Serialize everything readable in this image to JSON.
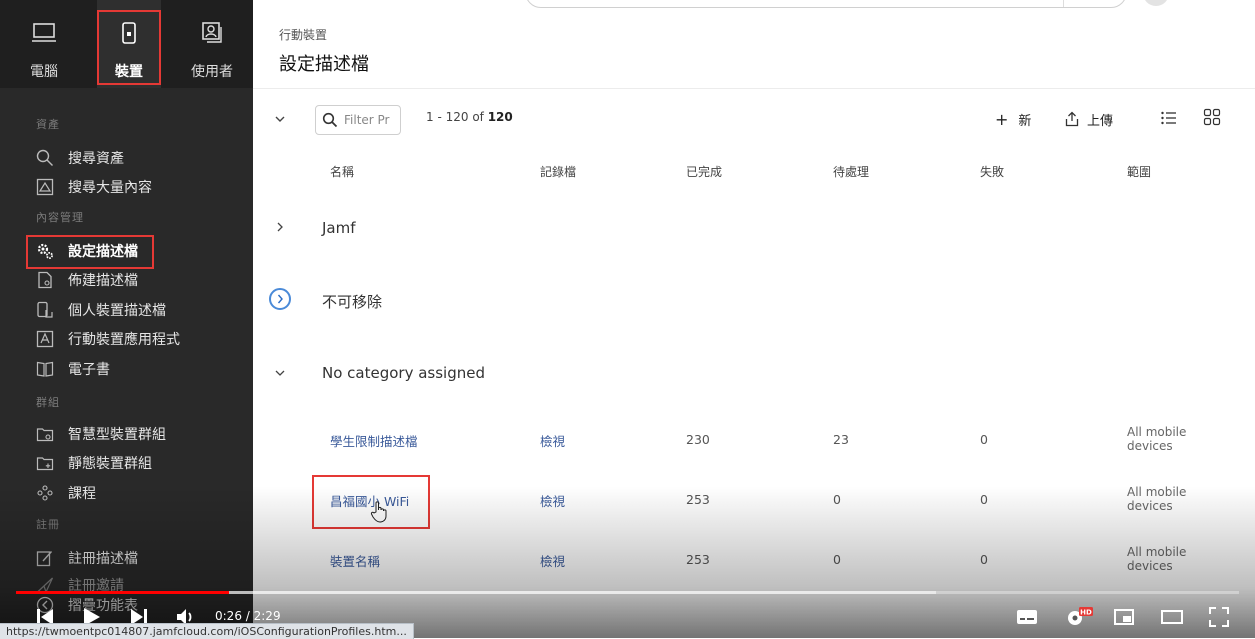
{
  "sidebar": {
    "tabs": [
      {
        "label": "電腦",
        "icon": "computer-icon"
      },
      {
        "label": "裝置",
        "icon": "mobile-device-icon"
      },
      {
        "label": "使用者",
        "icon": "users-icon"
      }
    ],
    "sections": {
      "assets": "資產",
      "content": "內容管理",
      "groups": "群組",
      "enrollment": "註冊"
    },
    "items": [
      {
        "label": "搜尋資產",
        "icon": "search-icon"
      },
      {
        "label": "搜尋大量內容",
        "icon": "image-search-icon"
      },
      {
        "label": "設定描述檔",
        "icon": "gears-icon"
      },
      {
        "label": "佈建描述檔",
        "icon": "provisioning-doc-icon"
      },
      {
        "label": "個人裝置描述檔",
        "icon": "personal-device-icon"
      },
      {
        "label": "行動裝置應用程式",
        "icon": "app-store-icon"
      },
      {
        "label": "電子書",
        "icon": "book-icon"
      },
      {
        "label": "智慧型裝置群組",
        "icon": "smart-group-folder-icon"
      },
      {
        "label": "靜態裝置群組",
        "icon": "static-group-folder-icon"
      },
      {
        "label": "課程",
        "icon": "classes-icon"
      },
      {
        "label": "註冊描述檔",
        "icon": "enrollment-doc-icon"
      },
      {
        "label": "註冊邀請",
        "icon": "invite-icon"
      },
      {
        "label": "摺疊功能表",
        "icon": "collapse-icon"
      }
    ]
  },
  "header": {
    "breadcrumb": "行動裝置",
    "title": "設定描述檔"
  },
  "toolbar": {
    "filter_placeholder": "Filter Pr",
    "count_prefix": "1 - 120 of ",
    "count_total": "120",
    "new_label": "新",
    "upload_label": "上傳"
  },
  "table": {
    "columns": [
      "名稱",
      "記錄檔",
      "已完成",
      "待處理",
      "失敗",
      "範圍"
    ],
    "categories": [
      "Jamf",
      "不可移除",
      "No category assigned"
    ],
    "rows": [
      {
        "name": "學生限制描述檔",
        "log": "檢視",
        "completed": "230",
        "pending": "23",
        "failed": "0",
        "scope_l1": "All mobile",
        "scope_l2": "devices"
      },
      {
        "name": "昌福國小 WiFi",
        "log": "檢視",
        "completed": "253",
        "pending": "0",
        "failed": "0",
        "scope_l1": "All mobile",
        "scope_l2": "devices"
      },
      {
        "name": "裝置名稱",
        "log": "檢視",
        "completed": "253",
        "pending": "0",
        "failed": "0",
        "scope_l1": "All mobile",
        "scope_l2": "devices"
      }
    ]
  },
  "player": {
    "current": "0:26",
    "sep": " / ",
    "duration": "2:29",
    "progress": 0.174,
    "hd_badge": "HD"
  },
  "status_url": "https://twmoentpc014807.jamfcloud.com/iOSConfigurationProfiles.htm...",
  "colors": {
    "accent_red": "#e53935",
    "sidebar_bg": "#292929",
    "link": "#3a5a9a",
    "progress": "#ff0000"
  }
}
